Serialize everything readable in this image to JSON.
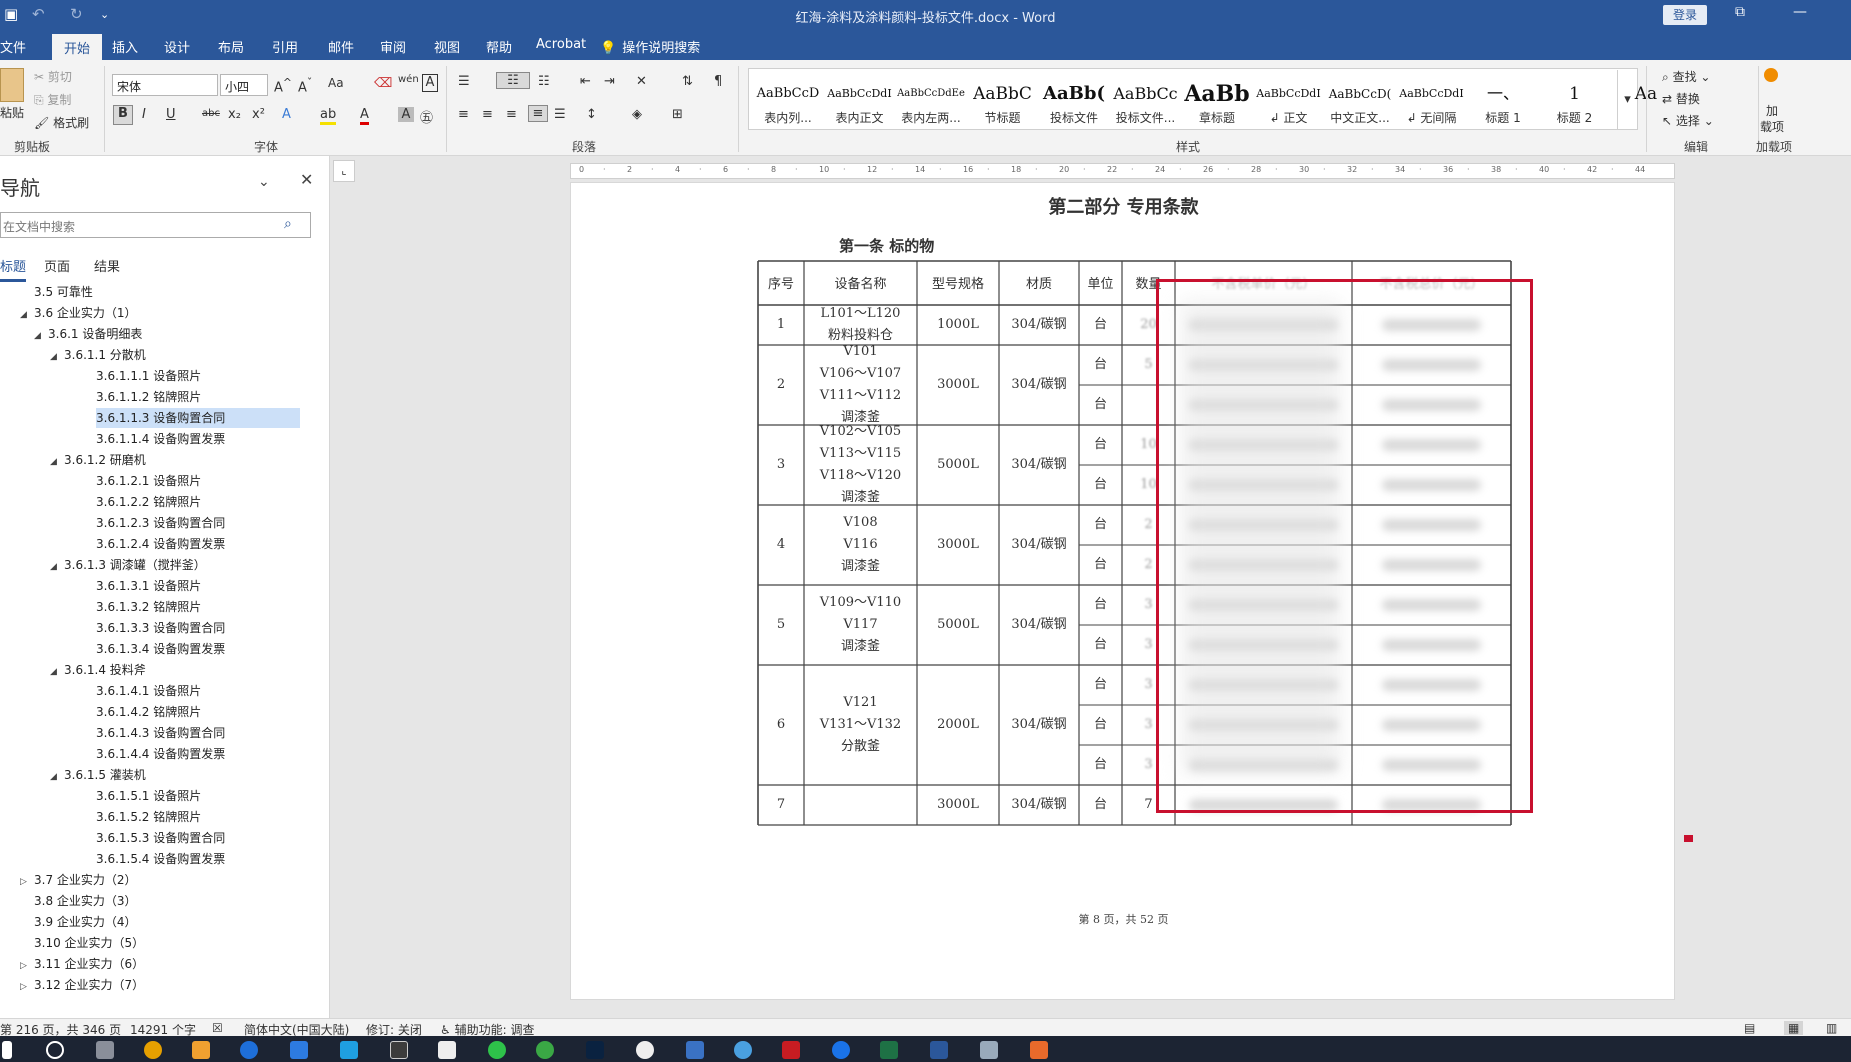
{
  "titlebar": {
    "title": "红海-涂料及涂料颜料-投标文件.docx - Word",
    "login": "登录",
    "save_icon": "save-icon",
    "undo_icon": "undo-icon",
    "redo_icon": "redo-icon"
  },
  "tabs": [
    "文件",
    "开始",
    "插入",
    "设计",
    "布局",
    "引用",
    "邮件",
    "审阅",
    "视图",
    "帮助",
    "Acrobat",
    "操作说明搜索"
  ],
  "active_tab": "开始",
  "ribbon": {
    "clipboard": {
      "paste": "粘贴",
      "cut": "剪切",
      "copy": "复制",
      "format_painter": "格式刷",
      "label": "剪贴板"
    },
    "font": {
      "name": "宋体",
      "size": "小四",
      "label": "字体",
      "case": "Aa"
    },
    "paragraph": {
      "label": "段落"
    },
    "styles": {
      "label": "样式",
      "items": [
        {
          "sample": "AaBbCcD",
          "name": "表内列..."
        },
        {
          "sample": "AaBbCcDdI",
          "name": "表内正文"
        },
        {
          "sample": "AaBbCcDdEe",
          "name": "表内左两..."
        },
        {
          "sample": "AaBbC",
          "name": "节标题"
        },
        {
          "sample": "AaBb(",
          "name": "投标文件"
        },
        {
          "sample": "AaBbCc",
          "name": "投标文件..."
        },
        {
          "sample": "AaBb",
          "name": "章标题"
        },
        {
          "sample": "AaBbCcDdI",
          "name": "↲ 正文"
        },
        {
          "sample": "AaBbCcD(",
          "name": "中文正文..."
        },
        {
          "sample": "AaBbCcDdI",
          "name": "↲ 无间隔"
        },
        {
          "sample": "一、",
          "name": "标题 1"
        },
        {
          "sample": "1",
          "name": "标题 2"
        },
        {
          "sample": "Aa",
          "name": ""
        }
      ]
    },
    "editing": {
      "find": "查找",
      "replace": "替换",
      "select": "选择",
      "label": "编辑"
    },
    "addins": {
      "load": "加",
      "load2": "载项",
      "label": "加载项"
    }
  },
  "nav": {
    "title": "导航",
    "search_placeholder": "在文档中搜索",
    "tabs": [
      "标题",
      "页面",
      "结果"
    ],
    "items": [
      {
        "text": "3.5 可靠性",
        "level": 1,
        "arrow": ""
      },
      {
        "text": "3.6 企业实力（1）",
        "level": 1,
        "arrow": "◢"
      },
      {
        "text": "3.6.1 设备明细表",
        "level": 2,
        "arrow": "◢"
      },
      {
        "text": "3.6.1.1 分散机",
        "level": 3,
        "arrow": "◢"
      },
      {
        "text": "3.6.1.1.1 设备照片",
        "level": 4,
        "arrow": ""
      },
      {
        "text": "3.6.1.1.2 铭牌照片",
        "level": 4,
        "arrow": ""
      },
      {
        "text": "3.6.1.1.3 设备购置合同",
        "level": 4,
        "arrow": "",
        "selected": true
      },
      {
        "text": "3.6.1.1.4 设备购置发票",
        "level": 4,
        "arrow": ""
      },
      {
        "text": "3.6.1.2 研磨机",
        "level": 3,
        "arrow": "◢"
      },
      {
        "text": "3.6.1.2.1 设备照片",
        "level": 4,
        "arrow": ""
      },
      {
        "text": "3.6.1.2.2 铭牌照片",
        "level": 4,
        "arrow": ""
      },
      {
        "text": "3.6.1.2.3 设备购置合同",
        "level": 4,
        "arrow": ""
      },
      {
        "text": "3.6.1.2.4 设备购置发票",
        "level": 4,
        "arrow": ""
      },
      {
        "text": "3.6.1.3 调漆罐（搅拌釜）",
        "level": 3,
        "arrow": "◢"
      },
      {
        "text": "3.6.1.3.1 设备照片",
        "level": 4,
        "arrow": ""
      },
      {
        "text": "3.6.1.3.2 铭牌照片",
        "level": 4,
        "arrow": ""
      },
      {
        "text": "3.6.1.3.3 设备购置合同",
        "level": 4,
        "arrow": ""
      },
      {
        "text": "3.6.1.3.4 设备购置发票",
        "level": 4,
        "arrow": ""
      },
      {
        "text": "3.6.1.4 投料斧",
        "level": 3,
        "arrow": "◢"
      },
      {
        "text": "3.6.1.4.1 设备照片",
        "level": 4,
        "arrow": ""
      },
      {
        "text": "3.6.1.4.2 铭牌照片",
        "level": 4,
        "arrow": ""
      },
      {
        "text": "3.6.1.4.3 设备购置合同",
        "level": 4,
        "arrow": ""
      },
      {
        "text": "3.6.1.4.4 设备购置发票",
        "level": 4,
        "arrow": ""
      },
      {
        "text": "3.6.1.5 灌装机",
        "level": 3,
        "arrow": "◢"
      },
      {
        "text": "3.6.1.5.1 设备照片",
        "level": 4,
        "arrow": ""
      },
      {
        "text": "3.6.1.5.2 铭牌照片",
        "level": 4,
        "arrow": ""
      },
      {
        "text": "3.6.1.5.3 设备购置合同",
        "level": 4,
        "arrow": ""
      },
      {
        "text": "3.6.1.5.4 设备购置发票",
        "level": 4,
        "arrow": ""
      },
      {
        "text": "3.7 企业实力（2）",
        "level": 1,
        "arrow": "▷"
      },
      {
        "text": "3.8 企业实力（3）",
        "level": 1,
        "arrow": ""
      },
      {
        "text": "3.9 企业实力（4）",
        "level": 1,
        "arrow": ""
      },
      {
        "text": "3.10 企业实力（5）",
        "level": 1,
        "arrow": ""
      },
      {
        "text": "3.11 企业实力（6）",
        "level": 1,
        "arrow": "▷"
      },
      {
        "text": "3.12 企业实力（7）",
        "level": 1,
        "arrow": "▷"
      }
    ]
  },
  "document": {
    "part_title": "第二部分  专用条款",
    "article_title": "第一条  标的物",
    "headers": [
      "序号",
      "设备名称",
      "型号规格",
      "材质",
      "单位",
      "数量",
      "不含税单价（元）",
      "不含税总价（元）"
    ],
    "rows": [
      {
        "no": "1",
        "name": [
          "L101～L120",
          "粉料投料仓"
        ],
        "spec": "1000L",
        "material": "304/碳钢",
        "units": [
          "台"
        ],
        "qty": [
          "20"
        ]
      },
      {
        "no": "2",
        "name": [
          "V101",
          "V106～V107",
          "V111～V112",
          "调漆釜"
        ],
        "spec": "3000L",
        "material": "304/碳钢",
        "units": [
          "台",
          "台"
        ],
        "qty": [
          "5",
          ""
        ]
      },
      {
        "no": "3",
        "name": [
          "V102～V105",
          "V113～V115",
          "V118～V120",
          "调漆釜"
        ],
        "spec": "5000L",
        "material": "304/碳钢",
        "units": [
          "台",
          "台"
        ],
        "qty": [
          "10",
          "10"
        ]
      },
      {
        "no": "4",
        "name": [
          "V108",
          "V116",
          "调漆釜"
        ],
        "spec": "3000L",
        "material": "304/碳钢",
        "units": [
          "台",
          "台"
        ],
        "qty": [
          "2",
          "2"
        ]
      },
      {
        "no": "5",
        "name": [
          "V109～V110",
          "V117",
          "调漆釜"
        ],
        "spec": "5000L",
        "material": "304/碳钢",
        "units": [
          "台",
          "台"
        ],
        "qty": [
          "3",
          "3"
        ]
      },
      {
        "no": "6",
        "name": [
          "V121",
          "V131～V132",
          "分散釜"
        ],
        "spec": "2000L",
        "material": "304/碳钢",
        "units": [
          "台",
          "台",
          "台"
        ],
        "qty": [
          "3",
          "3",
          "3"
        ]
      },
      {
        "no": "7",
        "name": [
          ""
        ],
        "spec": "3000L",
        "material": "304/碳钢",
        "units": [
          "台"
        ],
        "qty": [
          "7"
        ]
      }
    ],
    "footer": "第 8 页，共 52 页"
  },
  "status": {
    "pages": "第 216 页，共 346 页",
    "words": "14291 个字",
    "language": "简体中文(中国大陆)",
    "track": "修订: 关闭",
    "accessibility": "辅助功能: 调查"
  },
  "colors": {
    "accent": "#2b579a",
    "highlight": "#cce0f8",
    "redbox": "#c8102e"
  }
}
